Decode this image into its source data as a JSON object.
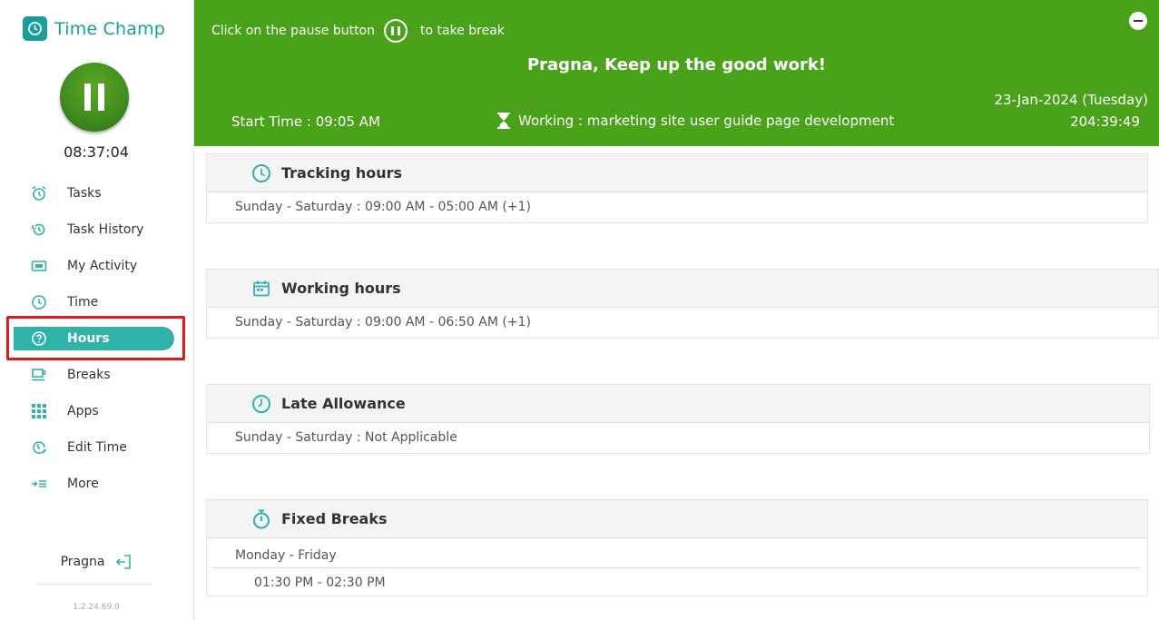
{
  "app": {
    "name": "Time Champ",
    "version": "1.2.24.69.0"
  },
  "timer": "08:37:04",
  "nav": {
    "items": [
      {
        "label": "Tasks",
        "icon": "alarm-clock-icon"
      },
      {
        "label": "Task History",
        "icon": "history-icon"
      },
      {
        "label": "My Activity",
        "icon": "activity-ticket-icon"
      },
      {
        "label": "Time",
        "icon": "clock-icon"
      },
      {
        "label": "Hours",
        "icon": "question-circle-icon",
        "active": true
      },
      {
        "label": "Breaks",
        "icon": "coffee-cup-icon"
      },
      {
        "label": "Apps",
        "icon": "grid-apps-icon"
      },
      {
        "label": "Edit Time",
        "icon": "edit-clock-icon"
      },
      {
        "label": "More",
        "icon": "more-arrow-list-icon"
      }
    ]
  },
  "user": {
    "name": "Pragna"
  },
  "banner": {
    "hint_before": "Click on the pause button",
    "hint_after": "to take break",
    "greeting": "Pragna, Keep up the good work!",
    "date": "23-Jan-2024 (Tuesday)",
    "start_time": "Start Time : 09:05 AM",
    "working": "Working : marketing site user guide page development",
    "elapsed": "204:39:49"
  },
  "cards": {
    "tracking": {
      "title": "Tracking hours",
      "line": "Sunday - Saturday : 09:00 AM - 05:00 AM (+1)"
    },
    "working": {
      "title": "Working hours",
      "line": "Sunday - Saturday : 09:00 AM - 06:50 AM (+1)"
    },
    "late": {
      "title": "Late Allowance",
      "line": "Sunday - Saturday : Not Applicable"
    },
    "breaks": {
      "title": "Fixed Breaks",
      "days": "Monday - Friday",
      "time": "01:30 PM - 02:30 PM"
    }
  },
  "colors": {
    "accent": "#1a9e9a",
    "banner": "#4aa21a",
    "active_pill": "#2fb3a8",
    "highlight": "#e0191e"
  }
}
